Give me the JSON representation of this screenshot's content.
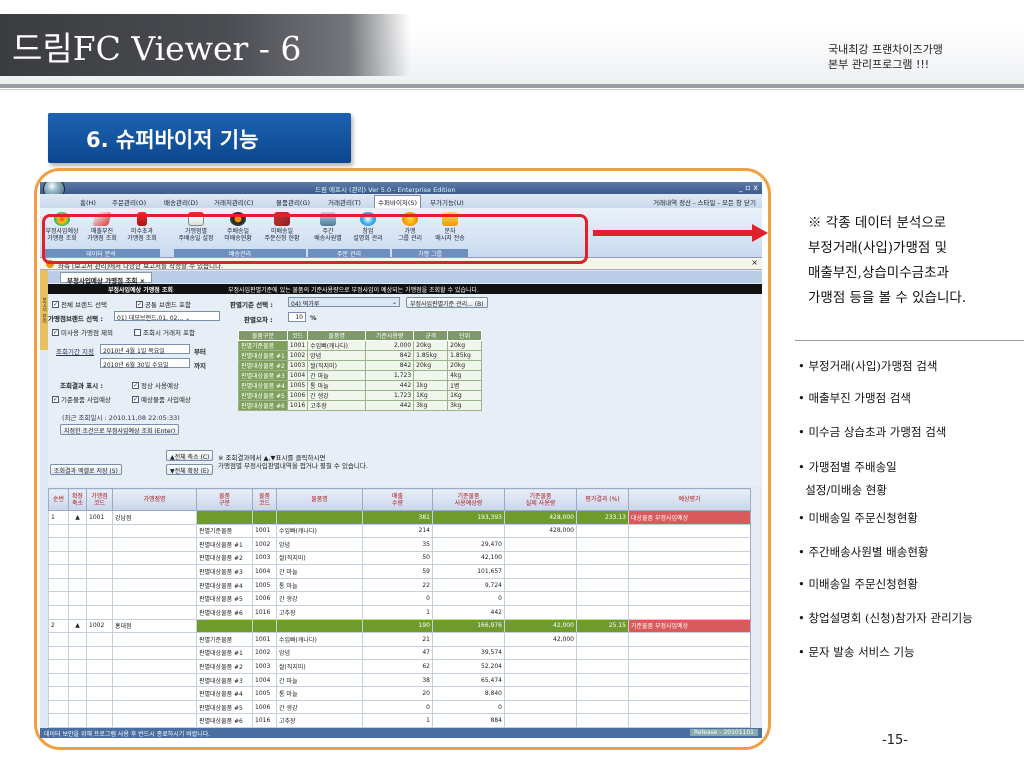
{
  "header": {
    "title": "드림FC Viewer - 6",
    "subtitle": "국내최강 프랜차이즈가맹\n본부 관리프로그램 !!!"
  },
  "section_badge": "6. 슈퍼바이저 기능",
  "app": {
    "window_title": "드림 에프시 (관리) Ver 5.0 - Enterprise Edition",
    "window_buttons": "_ ▫ x",
    "menus": [
      "홈(H)",
      "주문관리(O)",
      "배송관리(D)",
      "거래처관리(C)",
      "물품관리(G)",
      "거래관리(T)",
      "수퍼바이저(S)",
      "부가기능(U)"
    ],
    "menu_right": "거래내역 정산 - 스타일 - 모든 창 닫기",
    "ribbon_buttons": [
      "부정사입예상\n가맹점 조회",
      "매출부진\n가맹점 조회",
      "미수초과\n가맹점 조회",
      "가맹점별\n주배송일 설정",
      "주배송일\n미배송현황",
      "미배송일\n주문신청 현황",
      "주간\n배송사원별",
      "창업\n설명회 관리",
      "가맹\n그룹 관리",
      "문자\n메시지 전송"
    ],
    "ribbon_groups": [
      "데이터 분석",
      "배송관리",
      "주문 관리",
      "가맹 그룹"
    ],
    "notice": "좌측 [보고서 관리]에서 다양한 보고서를 작성할 수 있습니다.",
    "tab_label": "부정사입예상 가맹점 조회",
    "black_bar": {
      "left": "부정사입예상 가맹점 조회",
      "right": "부정사입판별기준에 있는 물품의 기준사용량으로 부정사입이 예상되는 가맹점을 조회할 수 있습니다."
    },
    "filters": {
      "all_brand": "전체 브랜드 선택",
      "common_brand": "공통 브랜드 포함",
      "brand_label": "가맹점브랜드 선택 :",
      "brand_value": "01) 데모브랜드,01, 02,..",
      "exclude_unused": "미사용 가맹점 제외",
      "include_no_trade": "조회시 거래처 포함",
      "period_label": "조회기간 지정",
      "from_date": "2010년  4월  1일 목요일",
      "from_suffix": "부터",
      "to_date": "2010년  6월 30일 수요일",
      "to_suffix": "까지",
      "display_label": "조회결과 표시 :",
      "normal_use": "정상 사용예상",
      "base_item_use": "기준물품 사입예상",
      "expected_item_use": "예상물품 사입예상",
      "last_query": "(최근 조회일시 : 2010,11,08 22:05:33)",
      "query_button": "지정한 조건으로 부정사입예상 조회 (Enter)",
      "criteria_label": "판별기준 선택 :",
      "criteria_value": "04) 떡가루",
      "criteria_button": "부정사입판별기준 관리... (B)",
      "error_label": "판별오차 :",
      "error_value": "10",
      "error_unit": "%",
      "collapse_button": "▲전체 축소 (C)",
      "expand_button": "▼전체 확장 (E)",
      "excel_button": "조회결과 엑셀로 저장 (S)",
      "hint": "※ 조회결과에서 ▲,▼표시를 클릭하시면\n가맹점별 부정사입판별내역을 접거나 펼칠 수 있습니다."
    },
    "item_table": {
      "headers": [
        "물품구분",
        "코드",
        "물품명",
        "기준사용량",
        "규격",
        "단위"
      ],
      "rows": [
        [
          "판별기준물품",
          "1001",
          "수입빠(캐나다)",
          "2,000",
          "20kg",
          "20kg"
        ],
        [
          "판별대상물품 #1",
          "1002",
          "앙념",
          "842",
          "1.85kg",
          "1.85kg"
        ],
        [
          "판별대상물품 #2",
          "1003",
          "쌀(직지미)",
          "842",
          "20kg",
          "20kg"
        ],
        [
          "판별대상물품 #3",
          "1004",
          "간 마늘",
          "1,723",
          "",
          "4kg"
        ],
        [
          "판별대상물품 #4",
          "1005",
          "통 마늘",
          "442",
          "1kg",
          "1병"
        ],
        [
          "판별대상물품 #5",
          "1006",
          "간 생강",
          "1,723",
          "1Kg",
          "1Kg"
        ],
        [
          "판별대상물품 #6",
          "1016",
          "고추장",
          "442",
          "3kg",
          "3kg"
        ]
      ]
    },
    "grid": {
      "headers": [
        "순번",
        "확장\n축소",
        "가맹점\n코드",
        "가맹점명",
        "물품\n구분",
        "물품\n코드",
        "물품명",
        "매출\n수량",
        "기준물품\n사용예상량",
        "기준물품\n실제 사용량",
        "평가결과 (%)",
        "예상평가"
      ],
      "rows": [
        {
          "group": true,
          "cells": [
            "1",
            "▲",
            "1001",
            "강남점",
            "",
            "",
            "",
            "381",
            "193,393",
            "428,000",
            "233.13",
            "대상물품 부정사입예상"
          ]
        },
        {
          "group": false,
          "cells": [
            "",
            "",
            "",
            "",
            "판별기준물품",
            "1001",
            "수입빠(캐나다)",
            "214",
            "",
            "428,000",
            "",
            ""
          ]
        },
        {
          "group": false,
          "cells": [
            "",
            "",
            "",
            "",
            "판별대상물품 #1",
            "1002",
            "앙념",
            "35",
            "29,470",
            "",
            "",
            ""
          ]
        },
        {
          "group": false,
          "cells": [
            "",
            "",
            "",
            "",
            "판별대상물품 #2",
            "1003",
            "쌀(직지미)",
            "50",
            "42,100",
            "",
            "",
            ""
          ]
        },
        {
          "group": false,
          "cells": [
            "",
            "",
            "",
            "",
            "판별대상물품 #3",
            "1004",
            "간 마늘",
            "59",
            "101,657",
            "",
            "",
            ""
          ]
        },
        {
          "group": false,
          "cells": [
            "",
            "",
            "",
            "",
            "판별대상물품 #4",
            "1005",
            "통 마늘",
            "22",
            "9,724",
            "",
            "",
            ""
          ]
        },
        {
          "group": false,
          "cells": [
            "",
            "",
            "",
            "",
            "판별대상물품 #5",
            "1006",
            "간 생강",
            "0",
            "0",
            "",
            "",
            ""
          ]
        },
        {
          "group": false,
          "cells": [
            "",
            "",
            "",
            "",
            "판별대상물품 #6",
            "1016",
            "고추장",
            "1",
            "442",
            "",
            "",
            ""
          ]
        },
        {
          "group": true,
          "cells": [
            "2",
            "▲",
            "1002",
            "홍대점",
            "",
            "",
            "",
            "190",
            "166,976",
            "42,000",
            "25.15",
            "기준물품 부정사입예상"
          ]
        },
        {
          "group": false,
          "cells": [
            "",
            "",
            "",
            "",
            "판별기준물품",
            "1001",
            "수입빠(캐나다)",
            "21",
            "",
            "42,000",
            "",
            ""
          ]
        },
        {
          "group": false,
          "cells": [
            "",
            "",
            "",
            "",
            "판별대상물품 #1",
            "1002",
            "앙념",
            "47",
            "39,574",
            "",
            "",
            ""
          ]
        },
        {
          "group": false,
          "cells": [
            "",
            "",
            "",
            "",
            "판별대상물품 #2",
            "1003",
            "쌀(직지미)",
            "62",
            "52,204",
            "",
            "",
            ""
          ]
        },
        {
          "group": false,
          "cells": [
            "",
            "",
            "",
            "",
            "판별대상물품 #3",
            "1004",
            "간 마늘",
            "38",
            "65,474",
            "",
            "",
            ""
          ]
        },
        {
          "group": false,
          "cells": [
            "",
            "",
            "",
            "",
            "판별대상물품 #4",
            "1005",
            "통 마늘",
            "20",
            "8,840",
            "",
            "",
            ""
          ]
        },
        {
          "group": false,
          "cells": [
            "",
            "",
            "",
            "",
            "판별대상물품 #5",
            "1006",
            "간 생강",
            "0",
            "0",
            "",
            "",
            ""
          ]
        },
        {
          "group": false,
          "cells": [
            "",
            "",
            "",
            "",
            "판별대상물품 #6",
            "1016",
            "고추장",
            "1",
            "884",
            "",
            "",
            ""
          ]
        }
      ]
    },
    "status": "데이터 보안을 위해 프로그램 사용 후 반드시 종료하시기 바랍니다.",
    "release": "Release - 20101101"
  },
  "callout": "※ 각종 데이터 분석으로\n부정거래(사입)가맹점 및\n매출부진,상습미수금초과\n가맹점 등을 볼 수 있습니다.",
  "bullets": [
    "• 부정거래(사입)가맹점 검색",
    "• 매출부진 가맹점 검색",
    "• 미수금 상습초과 가맹점 검색",
    "• 가맹점별 주배송일\n  설정/미배송 현황",
    "• 미배송일 주문신청현황",
    "• 주간배송사원별 배송현황",
    "• 미배송일 주문신청현황",
    "• 창업설명회 (신청)참가자 관리기능",
    "• 문자 발송 서비스 기능"
  ],
  "page_number": "-15-",
  "colors": {
    "accent_red": "#e0202a",
    "frame_orange": "#f0a040",
    "badge_blue": "#1d63b0",
    "group_green": "#6e9b2c"
  }
}
